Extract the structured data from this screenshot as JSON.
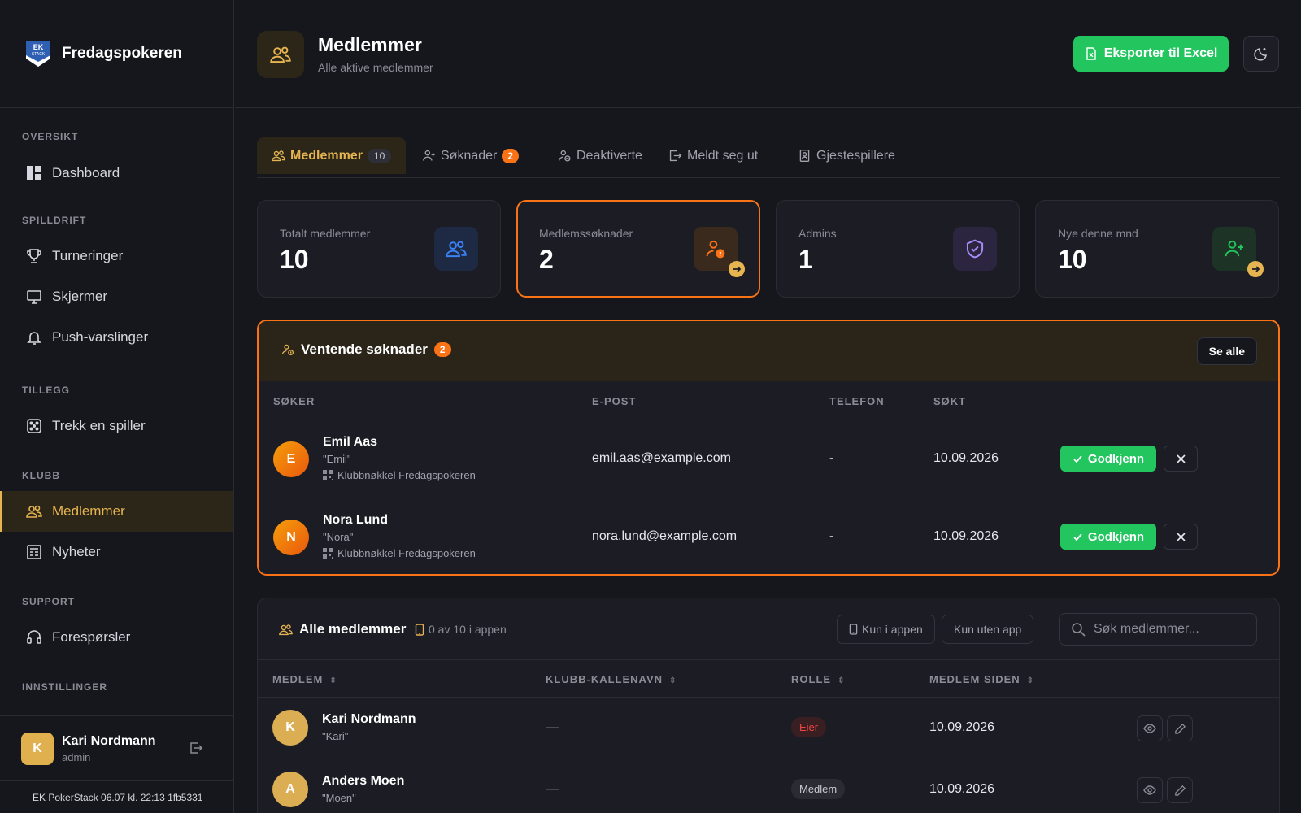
{
  "app": {
    "name": "Fredagspokeren",
    "logo_text": "EK STACK"
  },
  "sidebar": {
    "sections": [
      {
        "label": "OVERSIKT"
      },
      {
        "label": "SPILLDRIFT"
      },
      {
        "label": "TILLEGG"
      },
      {
        "label": "KLUBB"
      },
      {
        "label": "SUPPORT"
      },
      {
        "label": "INNSTILLINGER"
      }
    ],
    "items": [
      {
        "label": "Dashboard",
        "icon": "dashboard-icon"
      },
      {
        "label": "Turneringer",
        "icon": "trophy-icon"
      },
      {
        "label": "Skjermer",
        "icon": "monitor-icon"
      },
      {
        "label": "Push-varslinger",
        "icon": "bell-icon"
      },
      {
        "label": "Trekk en spiller",
        "icon": "dice-icon"
      },
      {
        "label": "Medlemmer",
        "icon": "users-icon",
        "active": true
      },
      {
        "label": "Nyheter",
        "icon": "newspaper-icon"
      },
      {
        "label": "Forespørsler",
        "icon": "headset-icon"
      }
    ],
    "user": {
      "initial": "K",
      "name": "Kari Nordmann",
      "role": "admin"
    },
    "version": "EK PokerStack 06.07 kl. 22:13 1fb5331"
  },
  "header": {
    "title": "Medlemmer",
    "subtitle": "Alle aktive medlemmer",
    "export_label": "Eksporter til Excel"
  },
  "tabs": [
    {
      "label": "Medlemmer",
      "count": "10"
    },
    {
      "label": "Søknader",
      "badge": "2"
    },
    {
      "label": "Deaktiverte"
    },
    {
      "label": "Meldt seg ut"
    },
    {
      "label": "Gjestespillere"
    }
  ],
  "stats": [
    {
      "label": "Totalt medlemmer",
      "value": "10"
    },
    {
      "label": "Medlemssøknader",
      "value": "2"
    },
    {
      "label": "Admins",
      "value": "1"
    },
    {
      "label": "Nye denne mnd",
      "value": "10"
    }
  ],
  "pending": {
    "title": "Ventende søknader",
    "badge": "2",
    "see_all": "Se alle",
    "columns": [
      "SØKER",
      "E-POST",
      "TELEFON",
      "SØKT"
    ],
    "approve_label": "Godkjenn",
    "rows": [
      {
        "initial": "E",
        "name": "Emil Aas",
        "nick": "\"Emil\"",
        "key": "Klubbnøkkel Fredagspokeren",
        "email": "emil.aas@example.com",
        "phone": "-",
        "date": "10.09.2026"
      },
      {
        "initial": "N",
        "name": "Nora Lund",
        "nick": "\"Nora\"",
        "key": "Klubbnøkkel Fredagspokeren",
        "email": "nora.lund@example.com",
        "phone": "-",
        "date": "10.09.2026"
      }
    ]
  },
  "members": {
    "title": "Alle medlemmer",
    "app_count": "0 av 10 i appen",
    "filter_app": "Kun i appen",
    "filter_noapp": "Kun uten app",
    "search_placeholder": "Søk medlemmer...",
    "columns": [
      "MEDLEM",
      "KLUBB-KALLENAVN",
      "ROLLE",
      "MEDLEM SIDEN"
    ],
    "rows": [
      {
        "initial": "K",
        "name": "Kari Nordmann",
        "nick": "\"Kari\"",
        "club_nick": "—",
        "role": "Eier",
        "since": "10.09.2026"
      },
      {
        "initial": "A",
        "name": "Anders Moen",
        "nick": "\"Moen\"",
        "club_nick": "—",
        "role": "Medlem",
        "since": "10.09.2026"
      }
    ]
  },
  "colors": {
    "accent": "#e6b450",
    "orange": "#f97316",
    "green": "#22c55e",
    "bg": "#16171d",
    "card": "#1c1d24"
  }
}
